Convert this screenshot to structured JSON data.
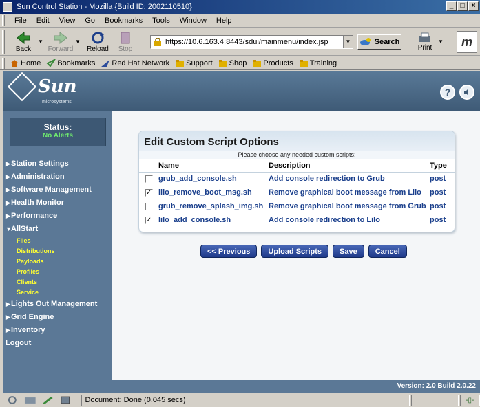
{
  "window": {
    "title": "Sun Control Station - Mozilla {Build ID: 2002110510}"
  },
  "menu": [
    "File",
    "Edit",
    "View",
    "Go",
    "Bookmarks",
    "Tools",
    "Window",
    "Help"
  ],
  "nav_toolbar": {
    "back": "Back",
    "forward": "Forward",
    "reload": "Reload",
    "stop": "Stop",
    "url": "https://10.6.163.4:8443/sdui/mainmenu/index.jsp",
    "search": "Search",
    "print": "Print"
  },
  "personal_toolbar": [
    "Home",
    "Bookmarks",
    "Red Hat Network",
    "Support",
    "Shop",
    "Products",
    "Training"
  ],
  "banner": {
    "logo": "Sun",
    "logo_sub": "microsystems",
    "help": "?"
  },
  "status": {
    "label": "Status:",
    "value": "No Alerts"
  },
  "sidebar": {
    "items": [
      "Station Settings",
      "Administration",
      "Software Management",
      "Health Monitor",
      "Performance",
      "AllStart"
    ],
    "allstart_sub": [
      "Files",
      "Distributions",
      "Payloads",
      "Profiles",
      "Clients",
      "Service"
    ],
    "items_after": [
      "Lights Out Management",
      "Grid Engine",
      "Inventory"
    ],
    "logout": "Logout"
  },
  "panel": {
    "title": "Edit Custom Script Options",
    "instructions": "Please choose any needed custom scripts:",
    "columns": [
      "Name",
      "Description",
      "Type"
    ],
    "rows": [
      {
        "checked": false,
        "name": "grub_add_console.sh",
        "description": "Add console redirection to Grub",
        "type": "post"
      },
      {
        "checked": true,
        "name": "lilo_remove_boot_msg.sh",
        "description": "Remove graphical boot message from Lilo",
        "type": "post"
      },
      {
        "checked": false,
        "name": "grub_remove_splash_img.sh",
        "description": "Remove graphical boot message from Grub",
        "type": "post"
      },
      {
        "checked": true,
        "name": "lilo_add_console.sh",
        "description": "Add console redirection to Lilo",
        "type": "post"
      }
    ]
  },
  "buttons": {
    "previous": "<< Previous",
    "upload": "Upload Scripts",
    "save": "Save",
    "cancel": "Cancel"
  },
  "footer": {
    "version": "Version: 2.0 Build 2.0.22"
  },
  "statusbar": {
    "text": "Document: Done (0.045 secs)"
  },
  "colors": {
    "sidebar": "#5b7896",
    "button": "#1f3a8a",
    "alerts": "#6ee66e",
    "submenu": "#ffff33"
  }
}
